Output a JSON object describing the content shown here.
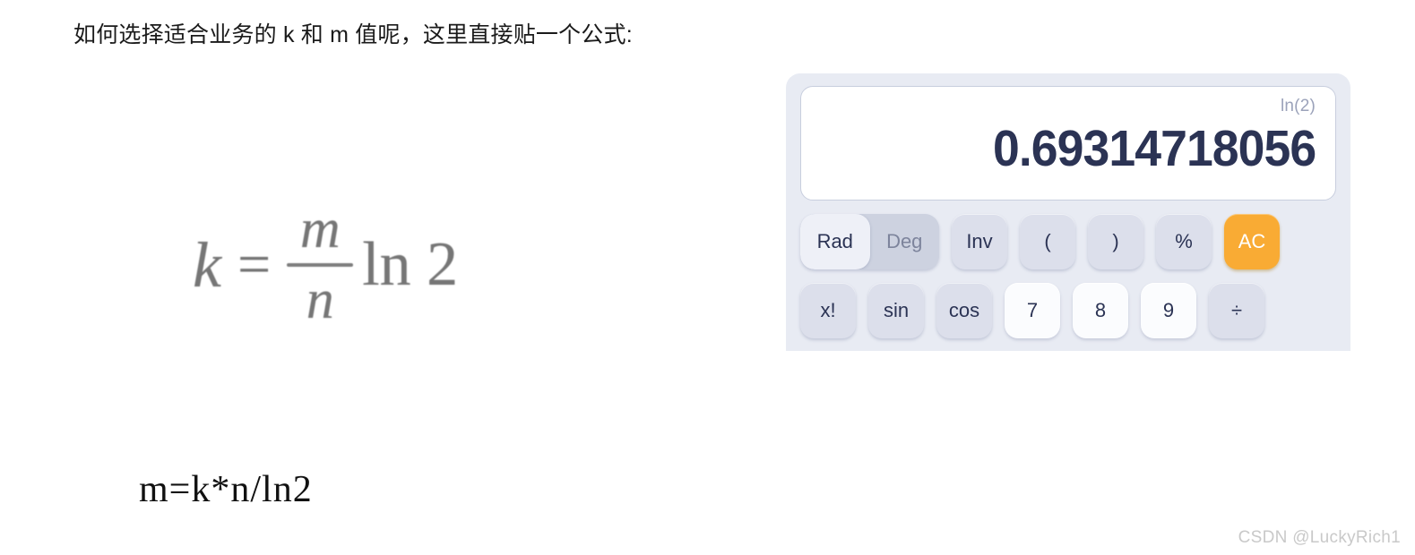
{
  "article": {
    "intro_text": "如何选择适合业务的 k 和 m 值呢，这里直接贴一个公式:",
    "formula_figure": {
      "lhs_variable": "k",
      "equals_sign": "=",
      "fraction_numerator": "m",
      "fraction_denominator": "n",
      "log_term": "ln 2",
      "plain": "k = (m/n) ln 2"
    },
    "plain_formula": "m=k*n/ln2"
  },
  "calculator": {
    "display": {
      "expression": "ln(2)",
      "result": "0.69314718056"
    },
    "angle_toggle": {
      "options": [
        "Rad",
        "Deg"
      ],
      "selected": "Rad"
    },
    "rows": [
      {
        "keys": [
          {
            "label": "Inv",
            "name": "inv-key",
            "style": "func"
          },
          {
            "label": "(",
            "name": "open-paren-key",
            "style": "func"
          },
          {
            "label": ")",
            "name": "close-paren-key",
            "style": "func"
          },
          {
            "label": "%",
            "name": "percent-key",
            "style": "func"
          },
          {
            "label": "AC",
            "name": "all-clear-key",
            "style": "accent"
          }
        ]
      },
      {
        "keys": [
          {
            "label": "x!",
            "name": "factorial-key",
            "style": "func"
          },
          {
            "label": "sin",
            "name": "sine-key",
            "style": "func"
          },
          {
            "label": "cos",
            "name": "cosine-key",
            "style": "func"
          },
          {
            "label": "7",
            "name": "digit-7-key",
            "style": "num"
          },
          {
            "label": "8",
            "name": "digit-8-key",
            "style": "num"
          },
          {
            "label": "9",
            "name": "digit-9-key",
            "style": "num"
          },
          {
            "label": "÷",
            "name": "divide-key",
            "style": "func"
          }
        ]
      }
    ],
    "colors": {
      "panel": "#e8ebf3",
      "key": "#dcdfeb",
      "key_number": "#fbfcfe",
      "accent": "#f9ab34",
      "text": "#2b3354",
      "muted": "#9ba2ba"
    }
  },
  "watermark": "CSDN @LuckyRich1"
}
